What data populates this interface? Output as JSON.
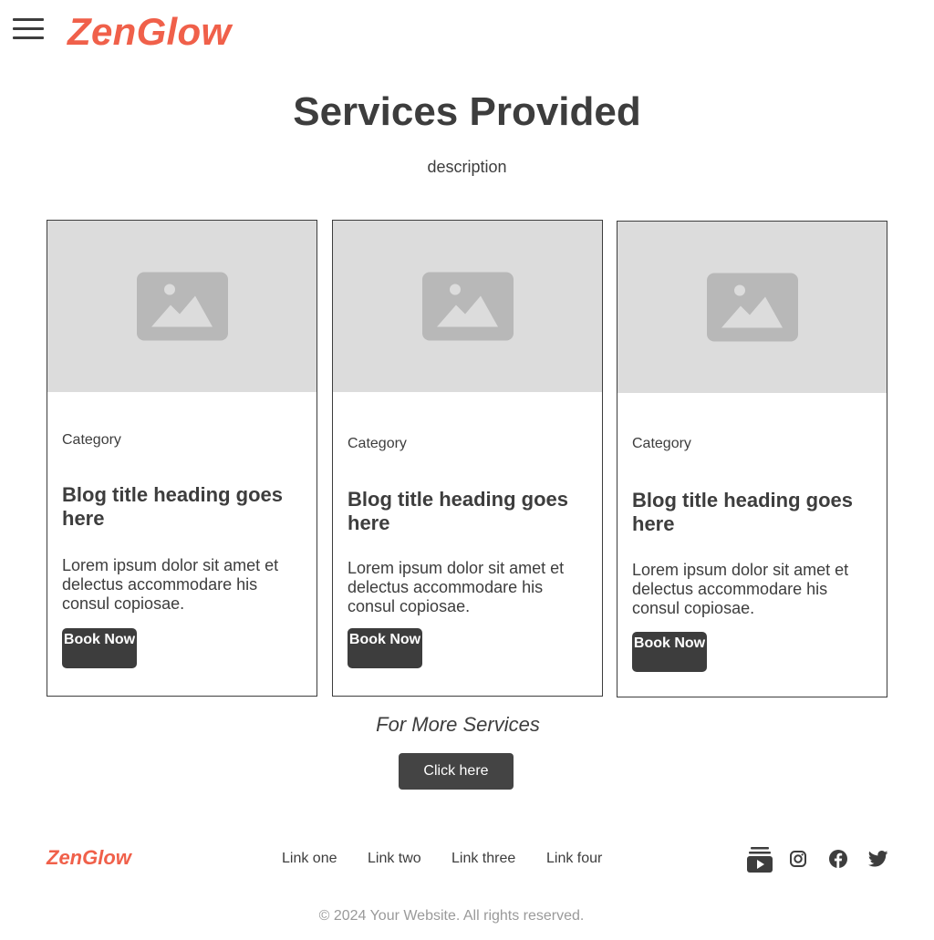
{
  "header": {
    "logo": "ZenGlow",
    "menu_icon": "hamburger-menu-icon"
  },
  "hero": {
    "title": "Services Provided",
    "description": "description"
  },
  "cards": [
    {
      "image_icon": "image-placeholder-icon",
      "category": "Category",
      "title": "Blog title heading goes here",
      "text": "Lorem ipsum dolor sit amet et delectus accommodare his consul copiosae.",
      "button": "Book Now"
    },
    {
      "image_icon": "image-placeholder-icon",
      "category": "Category",
      "title": "Blog title heading goes here",
      "text": "Lorem ipsum dolor sit amet et delectus accommodare his consul copiosae.",
      "button": "Book Now"
    },
    {
      "image_icon": "image-placeholder-icon",
      "category": "Category",
      "title": "Blog title heading goes here",
      "text": "Lorem ipsum dolor sit amet et delectus accommodare his consul copiosae.",
      "button": "Book Now"
    }
  ],
  "more": {
    "text": "For More Services",
    "button": "Click here"
  },
  "footer": {
    "logo": "ZenGlow",
    "links": [
      "Link one",
      "Link two",
      "Link three",
      "Link four"
    ],
    "social": [
      "youtube-icon",
      "instagram-icon",
      "facebook-icon",
      "twitter-icon"
    ],
    "copyright": "© 2024 Your Website. All rights reserved."
  },
  "colors": {
    "brand": "#f0604a",
    "text": "#3d3d3d",
    "button": "#3d3d3d",
    "placeholder": "#dcdcdc",
    "muted": "#9a9a9a"
  }
}
